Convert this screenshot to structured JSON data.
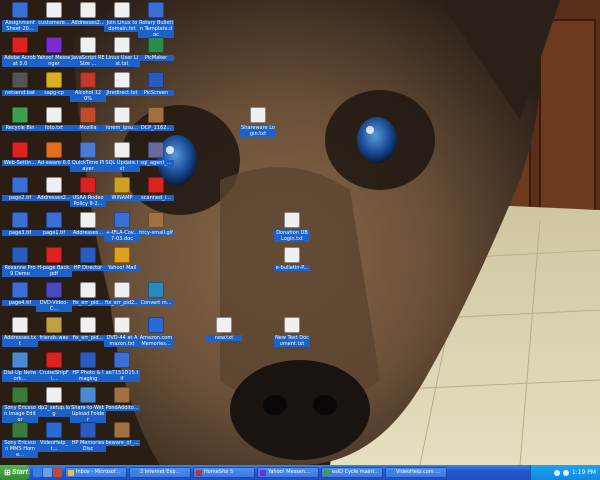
{
  "desktop": {
    "wallpaper_desc": "",
    "icons": [
      {
        "label": "Assignment Sheet 20...",
        "icon": "word-doc-icon",
        "color": "#3a6fd8"
      },
      {
        "label": "customere...",
        "icon": "text-file-icon",
        "color": "#f0f0f0"
      },
      {
        "label": "Addresses2...",
        "icon": "text-file-icon",
        "color": "#f0f0f0"
      },
      {
        "label": "Join Linux to domain.txt",
        "icon": "text-file-icon",
        "color": "#f0f0f0"
      },
      {
        "label": "Rotary Bulletin Template.doc",
        "icon": "word-doc-icon",
        "color": "#3a6fd8"
      },
      {
        "label": "Adobe Acrobat 5.0",
        "icon": "acrobat-icon",
        "color": "#d22"
      },
      {
        "label": "Yahoo! Messenger",
        "icon": "yahoo-icon",
        "color": "#7a2ad0"
      },
      {
        "label": "JavaScript RESize ...",
        "icon": "text-file-icon",
        "color": "#f0f0f0"
      },
      {
        "label": "Linux User List.txt",
        "icon": "text-file-icon",
        "color": "#f0f0f0"
      },
      {
        "label": "PicMaker",
        "icon": "app-icon",
        "color": "#2c8a4a"
      },
      {
        "label": "netsend.bat",
        "icon": "batch-file-icon",
        "color": "#555"
      },
      {
        "label": "sapg-cp",
        "icon": "app-icon",
        "color": "#d8b020"
      },
      {
        "label": "Alcohol 120%",
        "icon": "alcohol-icon",
        "color": "#c23a2a"
      },
      {
        "label": "Jtredirect.txt",
        "icon": "text-file-icon",
        "color": "#f0f0f0"
      },
      {
        "label": "PicScreen",
        "icon": "app-icon",
        "color": "#2a5cc0"
      },
      {
        "label": "Recycle Bin",
        "icon": "recycle-bin-icon",
        "color": "#3aa050"
      },
      {
        "label": "foto.txt",
        "icon": "text-file-icon",
        "color": "#f0f0f0"
      },
      {
        "label": "Mozilla",
        "icon": "mozilla-icon",
        "color": "#c04a2a"
      },
      {
        "label": "lorem_ipsu...",
        "icon": "text-file-icon",
        "color": "#f0f0f0"
      },
      {
        "label": "DCP_1162...",
        "icon": "image-file-icon",
        "color": "#a07040"
      },
      {
        "label": "Web-Settin...",
        "icon": "acrobat-icon",
        "color": "#d22"
      },
      {
        "label": "Ad-aware 6.0",
        "icon": "adaware-icon",
        "color": "#e07020"
      },
      {
        "label": "QuickTime Player",
        "icon": "quicktime-icon",
        "color": "#4a7ad8"
      },
      {
        "label": "SQL Update.txt",
        "icon": "text-file-icon",
        "color": "#f0f0f0"
      },
      {
        "label": "sql_agent_...",
        "icon": "app-icon",
        "color": "#6a6aa0"
      },
      {
        "label": "page2.tif",
        "icon": "tif-image-icon",
        "color": "#3a6fd8"
      },
      {
        "label": "Addresses2...",
        "icon": "text-file-icon",
        "color": "#f0f0f0"
      },
      {
        "label": "USAA Rodeo Policy 9-2...",
        "icon": "acrobat-icon",
        "color": "#d22"
      },
      {
        "label": "WINAMP",
        "icon": "winamp-icon",
        "color": "#d0a020"
      },
      {
        "label": "scanned_i...",
        "icon": "acrobat-icon",
        "color": "#d22"
      },
      {
        "label": "page3.tif",
        "icon": "tif-image-icon",
        "color": "#3a6fd8"
      },
      {
        "label": "page1.tif",
        "icon": "tif-image-icon",
        "color": "#3a6fd8"
      },
      {
        "label": "Addresses...",
        "icon": "text-file-icon",
        "color": "#f0f0f0"
      },
      {
        "label": "+-IFLA-Cov... 7-03.doc",
        "icon": "word-doc-icon",
        "color": "#3a6fd8"
      },
      {
        "label": "htcy-small.gif",
        "icon": "image-file-icon",
        "color": "#a07040"
      },
      {
        "label": "Roxanne Pro 9 Demo",
        "icon": "app-icon",
        "color": "#2a5cc0"
      },
      {
        "label": "H-page Back.pdf",
        "icon": "acrobat-icon",
        "color": "#d22"
      },
      {
        "label": "HP Director",
        "icon": "hp-icon",
        "color": "#2a5cc0"
      },
      {
        "label": "Yahoo! Mail",
        "icon": "yahoo-mail-icon",
        "color": "#e0a020"
      },
      {
        "label": "page4.tif",
        "icon": "tif-image-icon",
        "color": "#3a6fd8"
      },
      {
        "label": "DVD-Video-C...",
        "icon": "dvd-icon",
        "color": "#4a4ac0"
      },
      {
        "label": "fix_err_pid...",
        "icon": "text-file-icon",
        "color": "#f0f0f0"
      },
      {
        "label": "fix_err_pid2...",
        "icon": "text-file-icon",
        "color": "#f0f0f0"
      },
      {
        "label": "Convert m...",
        "icon": "app-icon",
        "color": "#2a8ac0"
      },
      {
        "label": "Addresses.txt",
        "icon": "text-file-icon",
        "color": "#f0f0f0"
      },
      {
        "label": "friends.wav",
        "icon": "audio-file-icon",
        "color": "#c0a040"
      },
      {
        "label": "fix_err_pid...",
        "icon": "text-file-icon",
        "color": "#f0f0f0"
      },
      {
        "label": "DVD-44 at Amazon.txt",
        "icon": "text-file-icon",
        "color": "#f0f0f0"
      },
      {
        "label": "Amazon.com Memories...",
        "icon": "ie-shortcut-icon",
        "color": "#2a6ad8"
      },
      {
        "label": "Dial-Up Network...",
        "icon": "dialup-icon",
        "color": "#4a8ad0"
      },
      {
        "label": "CruiseShipFi...",
        "icon": "acrobat-icon",
        "color": "#d22"
      },
      {
        "label": "HP Photo & Imaging",
        "icon": "hp-icon",
        "color": "#2a5cc0"
      },
      {
        "label": "ae7151D15.tif",
        "icon": "tif-image-icon",
        "color": "#3a6fd8"
      },
      {
        "label": "Sony Ericsson Image Editor",
        "icon": "app-icon",
        "color": "#3a7a3a"
      },
      {
        "label": "dp2_setup.log",
        "icon": "text-file-icon",
        "color": "#f0f0f0"
      },
      {
        "label": "Share-to-Web Upload Folder",
        "icon": "share-folder-icon",
        "color": "#4a8ad0"
      },
      {
        "label": "PondAddito...",
        "icon": "image-file-icon",
        "color": "#a07040"
      },
      {
        "label": "Sony Ericsson MMS Home...",
        "icon": "app-icon",
        "color": "#3a7a3a"
      },
      {
        "label": "VideoHelp_t...",
        "icon": "ie-shortcut-icon",
        "color": "#2a6ad8"
      },
      {
        "label": "HP Memories Disc",
        "icon": "hp-icon",
        "color": "#2a5cc0"
      },
      {
        "label": "beware_of_...",
        "icon": "image-file-icon",
        "color": "#a07040"
      },
      {
        "label": "Shareware Login.txt",
        "icon": "text-file-icon",
        "color": "#f0f0f0"
      },
      {
        "label": "Donation DB Login.txt",
        "icon": "text-file-icon",
        "color": "#f0f0f0"
      },
      {
        "label": "e-bulletin-P...",
        "icon": "text-file-icon",
        "color": "#f0f0f0"
      },
      {
        "label": "new.txt",
        "icon": "text-file-icon",
        "color": "#f0f0f0"
      },
      {
        "label": "New Text Document.txt",
        "icon": "text-file-icon",
        "color": "#f0f0f0"
      }
    ]
  },
  "taskbar": {
    "start_label": "Start",
    "quick_launch": [
      {
        "icon": "ie-icon",
        "color": "#3a80e0"
      },
      {
        "icon": "show-desktop-icon",
        "color": "#6aa0e0"
      },
      {
        "icon": "mozilla-icon",
        "color": "#c04a2a"
      }
    ],
    "tasks": [
      {
        "label": "Inbox - Microsof...",
        "icon": "outlook-icon",
        "color": "#f0c040"
      },
      {
        "label": "2 Internet Exp...",
        "icon": "ie-icon",
        "color": "#3a80e0"
      },
      {
        "label": "HomeSite 5",
        "icon": "homesite-icon",
        "color": "#c03030"
      },
      {
        "label": "Yahoo! Messen...",
        "icon": "yahoo-icon",
        "color": "#7a2ad0"
      },
      {
        "label": "esID Cycle maint...",
        "icon": "app-icon",
        "color": "#40a040"
      },
      {
        "label": "VideoHelp.com ...",
        "icon": "ie-icon",
        "color": "#3a80e0"
      }
    ],
    "clock": "1:19 PM"
  }
}
